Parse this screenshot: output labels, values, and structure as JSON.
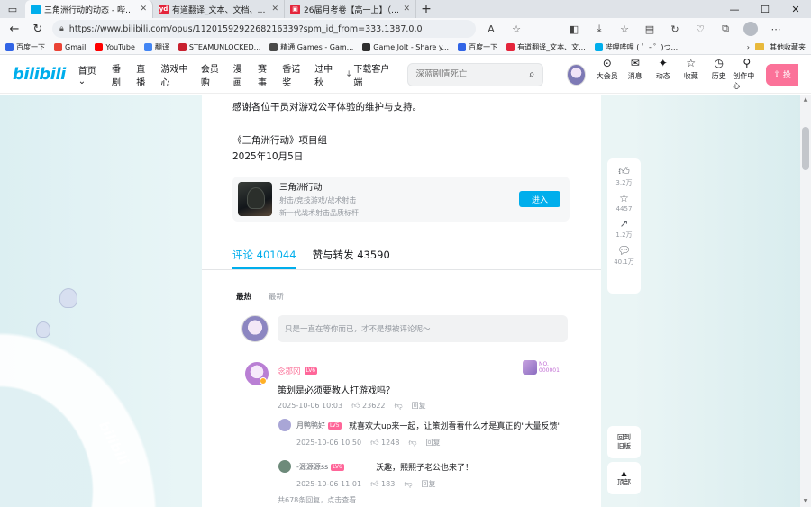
{
  "browser": {
    "tabs": [
      {
        "title": "三角洲行动的动态 - 哔哩哔哩",
        "favicon_color": "#00aeec",
        "favicon_glyph": "b",
        "active": true
      },
      {
        "title": "有道翻译_文本、文档、网页、在",
        "favicon_color": "#e4253b",
        "favicon_glyph": "yd",
        "active": false
      },
      {
        "title": "26届月考卷【高一上】（必修1",
        "favicon_color": "#e4253b",
        "favicon_glyph": "▣",
        "active": false
      }
    ],
    "url": "https://www.bilibili.com/opus/1120159292268216339?spm_id_from=333.1387.0.0"
  },
  "bookmarks": {
    "items": [
      {
        "label": "百度一下",
        "color": "#3164e6"
      },
      {
        "label": "Gmail",
        "color": "#ea4335"
      },
      {
        "label": "YouTube",
        "color": "#ff0000"
      },
      {
        "label": "翻译",
        "color": "#4285f4"
      },
      {
        "label": "STEAMUNLOCKED...",
        "color": "#c8202f"
      },
      {
        "label": "精通 Games - Gam...",
        "color": "#4a4a4a"
      },
      {
        "label": "Game Jolt - Share y...",
        "color": "#2f2f2f"
      },
      {
        "label": "百度一下",
        "color": "#3164e6"
      },
      {
        "label": "有道翻译_文本、文...",
        "color": "#e4253b"
      },
      {
        "label": "哔哩哔哩 ( ゜- ゜)つ...",
        "color": "#00aeec"
      }
    ],
    "other_folder": "其他收藏夹"
  },
  "header": {
    "logo": "bilibili",
    "nav": [
      "首页",
      "番剧",
      "直播",
      "游戏中心",
      "会员购",
      "漫画",
      "赛事",
      "香诺奖",
      "过中秋"
    ],
    "download": "下载客户端",
    "search_placeholder": "深蓝剧情死亡",
    "icons": [
      {
        "label": "大会员",
        "icon": "member-icon"
      },
      {
        "label": "消息",
        "icon": "message-icon"
      },
      {
        "label": "动态",
        "icon": "dynamic-icon"
      },
      {
        "label": "收藏",
        "icon": "favorite-icon"
      },
      {
        "label": "历史",
        "icon": "history-icon"
      },
      {
        "label": "创作中心",
        "icon": "creator-icon"
      }
    ],
    "upload": "投"
  },
  "article": {
    "line1": "感谢各位干员对游戏公平体验的维护与支持。",
    "line2": "《三角洲行动》项目组",
    "line3": "2025年10月5日",
    "game": {
      "name": "三角洲行动",
      "tags": "射击/竞技游戏/战术射击",
      "desc": "新一代战术射击品质标杆",
      "button": "进入"
    }
  },
  "comment_tabs": {
    "comments_label": "评论 401044",
    "reposts_label": "赞与转发 43590"
  },
  "sort": {
    "hot": "最热",
    "sep": "|",
    "new": "最新"
  },
  "reply_box": {
    "placeholder": "只是一直在等你而已，才不是想被评论呢～"
  },
  "comments": [
    {
      "user": "念郡冈",
      "level": "LV6",
      "badge_text": "NO.\n000001",
      "text": "策划是必须要教人打游戏吗？",
      "date": "2025-10-06 10:03",
      "likes": "23622",
      "reply_label": "回复"
    }
  ],
  "replies": [
    {
      "user": "月鸭鸭好",
      "level": "LV5",
      "text": "就喜欢大up来一起，让策划看看什么才是真正的\"大量反馈\"",
      "date": "2025-10-06 10:50",
      "likes": "1248",
      "reply_label": "回复",
      "avatar_color": "#a9a6d6"
    },
    {
      "user": "-源源源ss",
      "level": "LV6",
      "text": "沃趣，熙熙子老公也来了！",
      "date": "2025-10-06 11:01",
      "likes": "183",
      "reply_label": "回复",
      "avatar_color": "#6d8a7a"
    }
  ],
  "more_replies": "共678条回复，点击查看",
  "side_panel": {
    "likes": "3.2万",
    "favorites": "4457",
    "shares": "1.2万",
    "comments": "40.1万",
    "back_old": "回到\n旧版",
    "top": "顶部"
  },
  "watermark": "bilibili"
}
